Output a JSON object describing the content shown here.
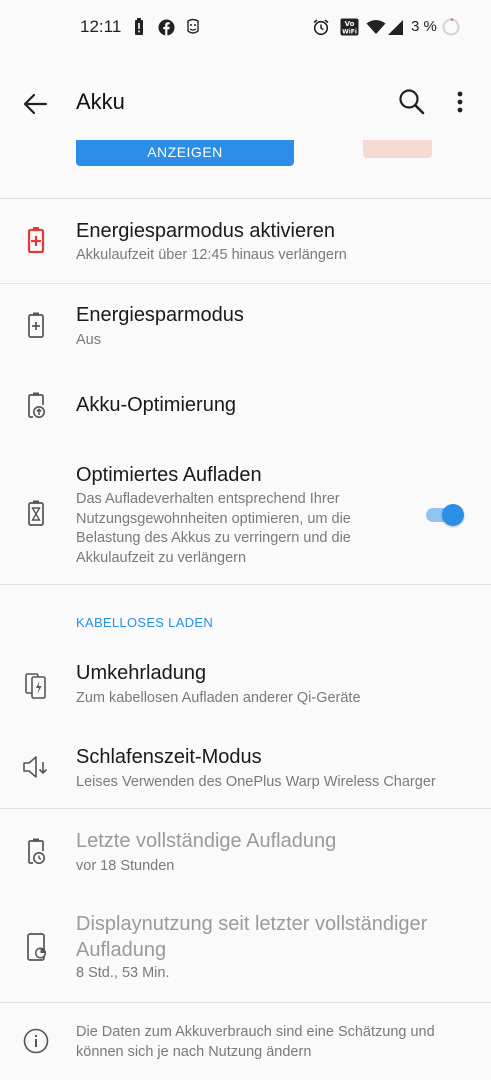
{
  "status_bar": {
    "time": "12:11",
    "battery_percent": "3 %",
    "battery_level": 0.03,
    "left_icons": [
      "battery-alert-icon",
      "facebook-icon",
      "notification-icon"
    ],
    "right_icons": [
      "alarm-icon",
      "volte-wifi-icon",
      "wifi-icon",
      "signal-icon"
    ]
  },
  "app_bar": {
    "title": "Akku"
  },
  "banner": {
    "button_label": "ANZEIGEN"
  },
  "settings": {
    "power_saver_activate": {
      "title": "Energiesparmodus aktivieren",
      "subtitle": "Akkulaufzeit über 12:45 hinaus verlängern"
    },
    "power_saver": {
      "title": "Energiesparmodus",
      "subtitle": "Aus"
    },
    "battery_optimization": {
      "title": "Akku-Optimierung"
    },
    "optimized_charging": {
      "title": "Optimiertes Aufladen",
      "subtitle": "Das Aufladeverhalten entsprechend Ihrer Nutzungsgewohnheiten optimieren, um die Belastung des Akkus zu verringern und die Akkulaufzeit zu verlängern",
      "enabled": true
    }
  },
  "wireless_section": {
    "header": "KABELLOSES LADEN",
    "reverse_charging": {
      "title": "Umkehrladung",
      "subtitle": "Zum kabellosen Aufladen anderer Qi-Geräte"
    },
    "bedtime_mode": {
      "title": "Schlafenszeit-Modus",
      "subtitle": "Leises Verwenden des OnePlus Warp Wireless Charger"
    }
  },
  "usage": {
    "last_full_charge": {
      "title": "Letzte vollständige Aufladung",
      "subtitle": "vor 18 Stunden"
    },
    "screen_usage": {
      "title": "Displaynutzung seit letzter vollständiger Aufladung",
      "subtitle": "8 Std., 53 Min."
    }
  },
  "footer": {
    "text": "Die Daten zum Akkuverbrauch sind eine Schätzung und können sich je nach Nutzung ändern"
  },
  "colors": {
    "accent": "#2b8fe8",
    "alert_red": "#e53935",
    "background": "#fafafa"
  }
}
